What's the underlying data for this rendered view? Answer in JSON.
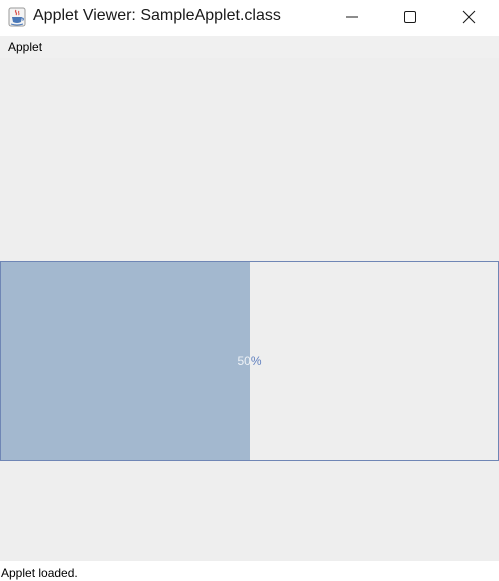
{
  "window": {
    "title": "Applet Viewer: SampleApplet.class",
    "icon": "java-cup-icon",
    "controls": {
      "minimize_icon": "minimize-icon",
      "maximize_icon": "maximize-icon",
      "close_icon": "close-icon"
    }
  },
  "menubar": {
    "items": [
      {
        "label": "Applet"
      }
    ]
  },
  "applet": {
    "progress": {
      "value_fraction": 0.5,
      "label_prefix": "50",
      "label_suffix": "%",
      "fill_color": "#a3b8cf",
      "border_color": "#6f86b5"
    }
  },
  "statusbar": {
    "text": "Applet loaded."
  },
  "colors": {
    "panel_background": "#eeeeee",
    "menubar_background": "#f0f0f0",
    "window_background": "#ffffff"
  }
}
